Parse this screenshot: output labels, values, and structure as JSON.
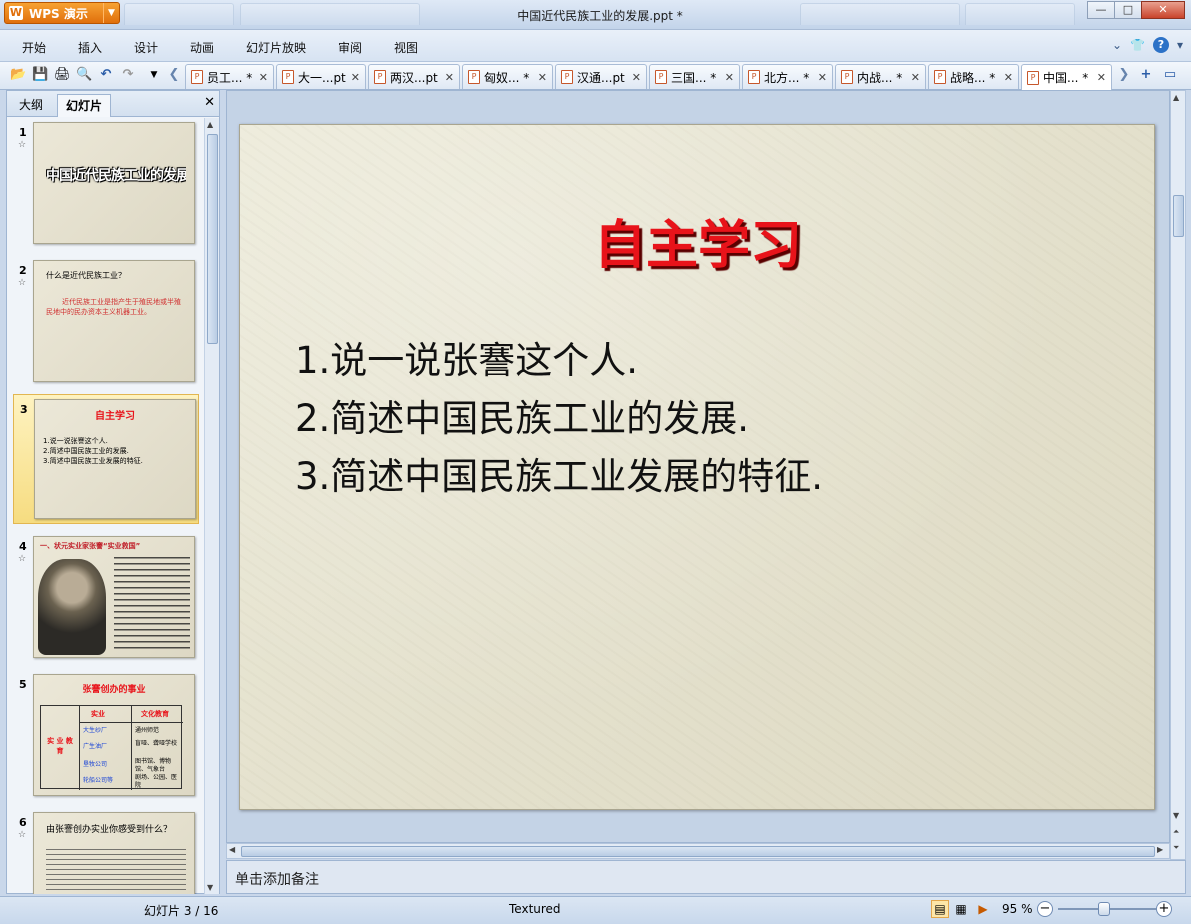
{
  "app": {
    "brand": "WPS 演示",
    "window_title": "中国近代民族工业的发展.ppt *"
  },
  "window_controls": {
    "minimize": "—",
    "maximize": "□",
    "close": "✕"
  },
  "menu": [
    "开始",
    "插入",
    "设计",
    "动画",
    "幻灯片放映",
    "审阅",
    "视图"
  ],
  "doc_tabs": [
    {
      "label": "员工... *",
      "active": false
    },
    {
      "label": "大一...pt",
      "active": false
    },
    {
      "label": "两汉...pt",
      "active": false
    },
    {
      "label": "匈奴... *",
      "active": false
    },
    {
      "label": "汉通...pt",
      "active": false
    },
    {
      "label": "三国... *",
      "active": false
    },
    {
      "label": "北方... *",
      "active": false
    },
    {
      "label": "内战... *",
      "active": false
    },
    {
      "label": "战略... *",
      "active": false
    },
    {
      "label": "中国... *",
      "active": true
    }
  ],
  "panel": {
    "tab_outline": "大纲",
    "tab_slides": "幻灯片",
    "active_tab": "幻灯片"
  },
  "thumbnails": {
    "s1": {
      "num": "1",
      "text": "中国近代民族工业的发展"
    },
    "s2": {
      "num": "2",
      "q": "什么是近代民族工业？",
      "a": "近代民族工业是指产生于殖民地或半殖民地中的民办资本主义机器工业。"
    },
    "s3": {
      "num": "3",
      "title": "自主学习",
      "l1": "1.说一说张謇这个人.",
      "l2": "2.简述中国民族工业的发展.",
      "l3": "3.简述中国民族工业发展的特征."
    },
    "s4": {
      "num": "4",
      "title": "一、状元实业家张謇“实业救国”"
    },
    "s5": {
      "num": "5",
      "title": "张謇创办的事业",
      "c1": "实业",
      "c2": "文化教育",
      "side": "实 业 教 育",
      "r1a": "大生纱厂",
      "r1b": "通州师范",
      "r2a": "广生油厂",
      "r2b": "盲哑、聋哑学校",
      "r3a": "垦牧公司",
      "r3b": "图书馆、博物馆、气象台",
      "r4a": "轮船公司等",
      "r4b": "剧场、公园、医院"
    },
    "s6": {
      "num": "6",
      "q": "由张謇创办实业你感受到什么？"
    }
  },
  "slide": {
    "title": "自主学习",
    "bullets": [
      "1.说一说张謇这个人.",
      "2.简述中国民族工业的发展.",
      "3.简述中国民族工业发展的特征."
    ]
  },
  "notes_placeholder": "单击添加备注",
  "status": {
    "slide_count": "幻灯片 3 / 16",
    "theme": "Textured",
    "zoom": "95 %",
    "zoom_value": 95
  }
}
